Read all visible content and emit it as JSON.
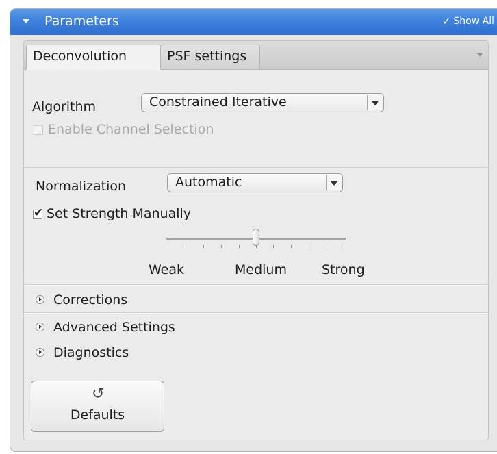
{
  "panel": {
    "title": "Parameters",
    "show_all_check": "✓",
    "show_all": "Show All"
  },
  "tabs": [
    {
      "label": "Deconvolution",
      "active": true
    },
    {
      "label": "PSF settings",
      "active": false
    }
  ],
  "algorithm": {
    "label": "Algorithm",
    "value": "Constrained Iterative"
  },
  "enable_channel_selection": {
    "label": "Enable Channel Selection",
    "checked": false,
    "enabled": false
  },
  "normalization": {
    "label": "Normalization",
    "value": "Automatic"
  },
  "strength": {
    "checkbox_label": "Set Strength Manually",
    "checked": true,
    "level_fraction": 0.5,
    "labels": [
      "Weak",
      "Medium",
      "Strong"
    ]
  },
  "sections": [
    {
      "label": "Corrections"
    },
    {
      "label": "Advanced Settings"
    },
    {
      "label": "Diagnostics"
    }
  ],
  "defaults_button": {
    "icon": "reset-icon",
    "icon_glyph": "↺",
    "label": "Defaults"
  },
  "colors": {
    "titlebar": "#3f82dc",
    "panel_bg": "#e6e6e6"
  }
}
